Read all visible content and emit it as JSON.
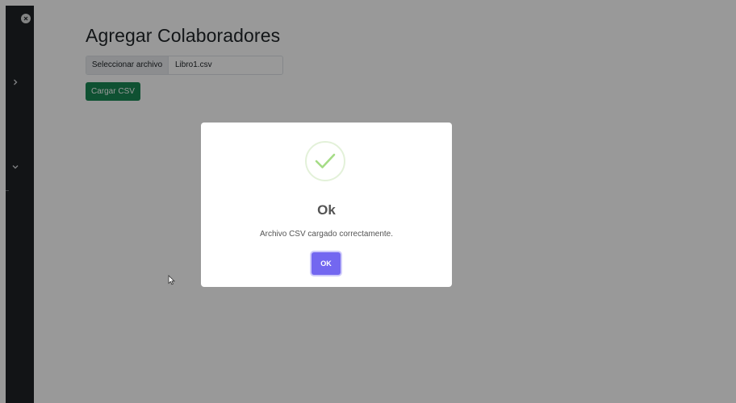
{
  "page": {
    "title": "Agregar Colaboradores",
    "file_input": {
      "button_label": "Seleccionar archivo",
      "file_name": "Libro1.csv"
    },
    "upload_button_label": "Cargar CSV"
  },
  "sidebar": {
    "icons": [
      "close-icon",
      "chevron-right-icon",
      "chevron-down-icon"
    ]
  },
  "dialog": {
    "icon": "success-check-icon",
    "title": "Ok",
    "message": "Archivo CSV cargado correctamente.",
    "confirm_label": "OK"
  },
  "colors": {
    "sidebar_bg": "#1e2226",
    "upload_button": "#198754",
    "confirm_button": "#7367f0",
    "success_check": "#a5dc86"
  }
}
